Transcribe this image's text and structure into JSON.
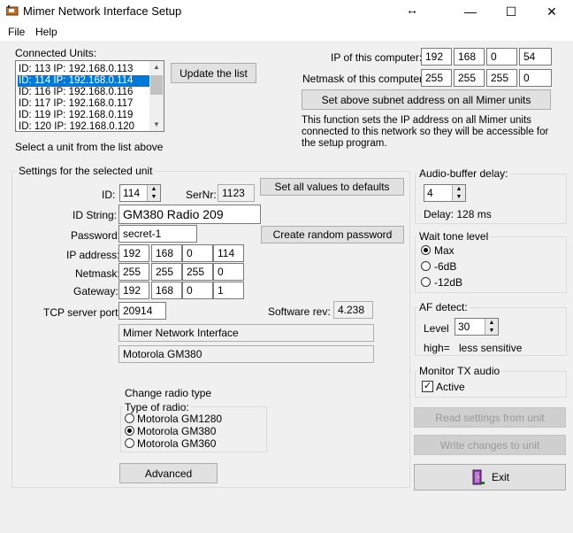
{
  "window": {
    "title": "Mimer Network Interface Setup",
    "minimize": "—",
    "maximize": "☐",
    "close": "✕",
    "resize_glyph": "↔"
  },
  "menu": {
    "file": "File",
    "help": "Help"
  },
  "connected": {
    "label": "Connected Units:",
    "units": [
      {
        "text": "ID: 113  IP: 192.168.0.113",
        "selected": false
      },
      {
        "text": "ID: 114  IP: 192.168.0.114",
        "selected": true
      },
      {
        "text": "ID: 116  IP: 192.168.0.116",
        "selected": false
      },
      {
        "text": "ID: 117  IP: 192.168.0.117",
        "selected": false
      },
      {
        "text": "ID: 119  IP: 192.168.0.119",
        "selected": false
      },
      {
        "text": "ID: 120  IP: 192.168.0.120",
        "selected": false
      }
    ],
    "update_button": "Update the list",
    "hint": "Select a unit from the list above"
  },
  "network": {
    "ip_label": "IP of this computer:",
    "ip": [
      "192",
      "168",
      "0",
      "54"
    ],
    "netmask_label": "Netmask of this computer:",
    "netmask": [
      "255",
      "255",
      "255",
      "0"
    ],
    "set_subnet_button": "Set above subnet address on all Mimer units",
    "description": "This function sets the IP address on all Mimer units connected to this network so they will be accessible for the setup program."
  },
  "unit_settings": {
    "group_label": "Settings for the selected unit",
    "id_label": "ID:",
    "id_value": "114",
    "sernr_label": "SerNr:",
    "sernr_value": "1123",
    "defaults_button": "Set all values to defaults",
    "idstring_label": "ID String:",
    "idstring_value": "GM380 Radio 209",
    "password_label": "Password:",
    "password_value": "secret-1",
    "random_password_button": "Create random password",
    "ip_label": "IP address:",
    "ip": [
      "192",
      "168",
      "0",
      "114"
    ],
    "netmask_label": "Netmask:",
    "netmask": [
      "255",
      "255",
      "255",
      "0"
    ],
    "gateway_label": "Gateway:",
    "gateway": [
      "192",
      "168",
      "0",
      "1"
    ],
    "tcp_label": "TCP server port:",
    "tcp_value": "20914",
    "swrev_label": "Software rev:",
    "swrev_value": "4.238",
    "info_line1": "Mimer Network Interface",
    "info_line2": "Motorola GM380",
    "change_radio_label": "Change radio type",
    "radio_type_label": "Type of radio:",
    "radio_types": [
      {
        "label": "Motorola GM1280",
        "checked": false
      },
      {
        "label": "Motorola GM380",
        "checked": true
      },
      {
        "label": "Motorola GM360",
        "checked": false
      }
    ],
    "advanced_button": "Advanced"
  },
  "audio_buffer": {
    "label": "Audio-buffer delay:",
    "value": "4",
    "delay_text": "Delay: 128 ms"
  },
  "wait_tone": {
    "label": "Wait tone level",
    "options": [
      {
        "label": "Max",
        "checked": true
      },
      {
        "label": "-6dB",
        "checked": false
      },
      {
        "label": "-12dB",
        "checked": false
      }
    ]
  },
  "af_detect": {
    "label": "AF detect:",
    "level_label": "Level",
    "level_value": "30",
    "high_label": "high=",
    "sensitivity": "less sensitive"
  },
  "monitor_tx": {
    "label": "Monitor TX audio",
    "active_label": "Active",
    "checked": true
  },
  "actions": {
    "read": "Read settings from unit",
    "write": "Write changes to unit",
    "exit": "Exit"
  }
}
